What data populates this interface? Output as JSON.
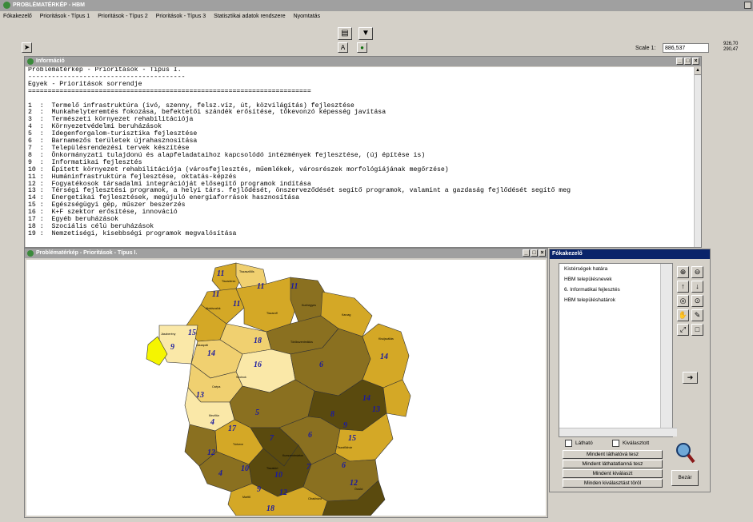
{
  "app": {
    "title": "PROBLÉMATÉRKÉP - HBM"
  },
  "menu": [
    "Fókakezelő",
    "Prioritások - Típus 1",
    "Prioritások - Típus 2",
    "Prioritások - Típus 3",
    "Statisztikai adatok rendszere",
    "Nyomtatás"
  ],
  "toolbar": {
    "scale_label": "Scale 1:",
    "scale_value": "886,537",
    "coord_x": "926,70",
    "coord_y": "290,47"
  },
  "info_window": {
    "title": "Információ",
    "lines": [
      "Problématérkép - Prioritások - Típus I.",
      "----------------------------------------",
      "Egyek - Prioritások sorrendje",
      "========================================================================",
      "",
      "1  :  Termelő infrastruktúra (ivó, szenny, felsz.víz, út, közvilágítás) fejlesztése",
      "2  :  Munkahelyteremtés fokozása, befektetői szándék erősítése, tőkevonzó képesség javítása",
      "3  :  Természeti környezet rehabilitációja",
      "4  :  Környezetvédelmi beruházások",
      "5  :  Idegenforgalom-turisztika fejlesztése",
      "6  :  Barnamezős területek újrahasznosítása",
      "7  :  Településrendezési tervek készítése",
      "8  :  Önkormányzati tulajdonú és alapfeladataihoz kapcsolódó intézmények fejlesztése, (új építése is)",
      "9  :  Informatikai fejlesztés",
      "10 :  Épített környezet rehabilitációja (városfejlesztés, műemlékek, városrészek morfológiájának megőrzése)",
      "11 :  Humáninfrastruktúra fejlesztése, oktatás-képzés",
      "12 :  Fogyatékosok társadalmi integrációját elősegítő programok indítása",
      "13 :  Térségi fejlesztési programok, a helyi társ. fejlődését, önszerveződését segítő programok, valamint a gazdaság fejlődését segítő meg",
      "14 :  Energetikai fejlesztések, megújuló energiaforrások hasznosítása",
      "15 :  Egészségügyi gép, műszer beszerzés",
      "16 :  K+F szektor erősítése, innováció",
      "17 :  Egyéb beruházások",
      "18 :  Szociális célú beruházások",
      "19 :  Nemzetiségi, kisebbségi programok megvalósítása"
    ]
  },
  "map_window": {
    "title": "Problématérkép - Prioritások - Típus I."
  },
  "map": {
    "colors": {
      "dark": "#5a4a0e",
      "mid": "#8a7020",
      "gold": "#d4a826",
      "light": "#f0d070",
      "pale": "#fae8a8",
      "yellow": "#f5f500",
      "border": "#333333",
      "label": "#1a1aa0"
    },
    "big_labels": [
      "11",
      "11",
      "11",
      "11",
      "11",
      "15",
      "9",
      "18",
      "14",
      "16",
      "6",
      "14",
      "13",
      "4",
      "17",
      "12",
      "10",
      "9",
      "12",
      "18",
      "10",
      "6",
      "7",
      "5",
      "8",
      "9",
      "14",
      "13",
      "15",
      "7",
      "6",
      "12",
      "4"
    ],
    "small_labels": [
      "Tiszaderzs",
      "Tiszaszőlős",
      "Abádszalók",
      "Tiszaroff",
      "Kunhegyes",
      "Jászberény",
      "Jászapáti",
      "Szolnok",
      "Törökszentmiklós",
      "Karcag",
      "Kisújszállás",
      "Mezőtúr",
      "Túrkeve",
      "Kunszentmárton",
      "Tiszaföldvár",
      "Martfű",
      "Cibakháza",
      "Öcsöd",
      "Tiszakürt",
      "Csépa"
    ]
  },
  "layer_panel": {
    "title": "Fókakezelő",
    "layers": [
      "Kistérségek határa",
      "HBM településnevek",
      "6. Informatikai fejlesztés",
      "HBM településhatárok"
    ],
    "visible_label": "Látható",
    "selected_label": "Kiválasztott",
    "buttons": [
      "Mindent láthatóvá tesz",
      "Mindent láthatatlanná tesz",
      "Mindent kiválaszt",
      "Minden kiválasztást töröl"
    ],
    "close_label": "Bezár"
  }
}
